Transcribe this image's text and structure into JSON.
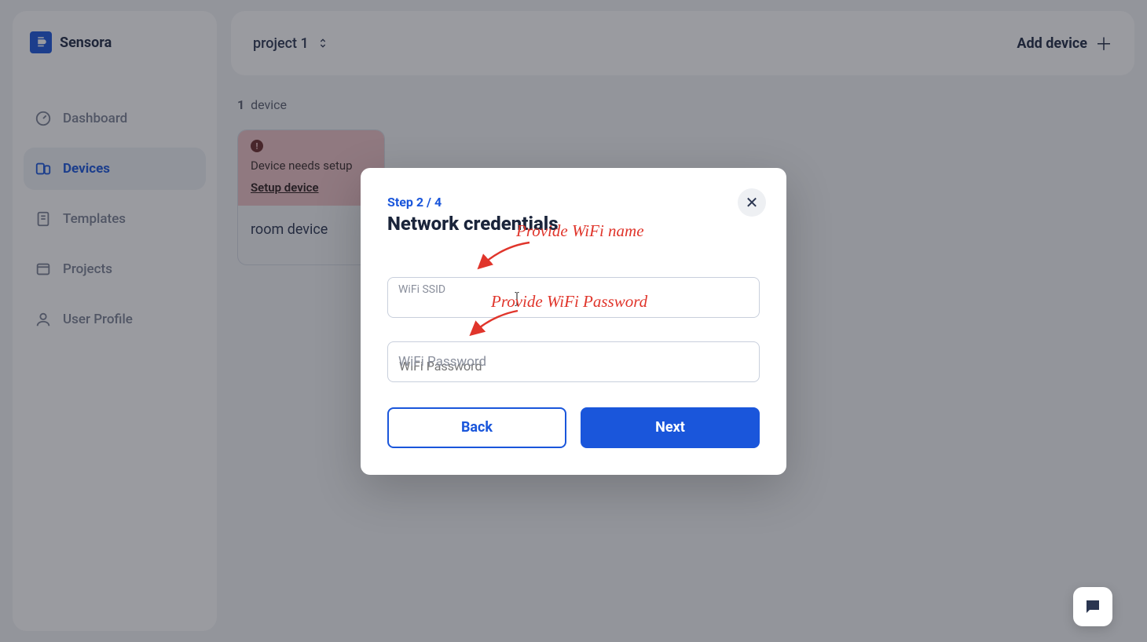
{
  "brand": {
    "name": "Sensora"
  },
  "sidebar": {
    "items": [
      {
        "label": "Dashboard",
        "icon": "dashboard",
        "active": false
      },
      {
        "label": "Devices",
        "icon": "devices",
        "active": true
      },
      {
        "label": "Templates",
        "icon": "templates",
        "active": false
      },
      {
        "label": "Projects",
        "icon": "projects",
        "active": false
      },
      {
        "label": "User Profile",
        "icon": "user",
        "active": false
      }
    ]
  },
  "topbar": {
    "project_label": "project 1",
    "add_device_label": "Add device"
  },
  "content": {
    "device_count_num": "1",
    "device_count_word": "device",
    "card": {
      "warn_text": "Device needs setup",
      "setup_link": "Setup device",
      "device_name": "room device"
    }
  },
  "modal": {
    "step_label": "Step 2 / 4",
    "title": "Network credentials",
    "ssid_label": "WiFi SSID",
    "ssid_value": "",
    "password_placeholder": "WiFi Password",
    "back_label": "Back",
    "next_label": "Next",
    "close_glyph": "✕"
  },
  "annotations": {
    "ssid_hint": "Provide WiFi name",
    "password_hint": "Provide WiFi Password"
  }
}
